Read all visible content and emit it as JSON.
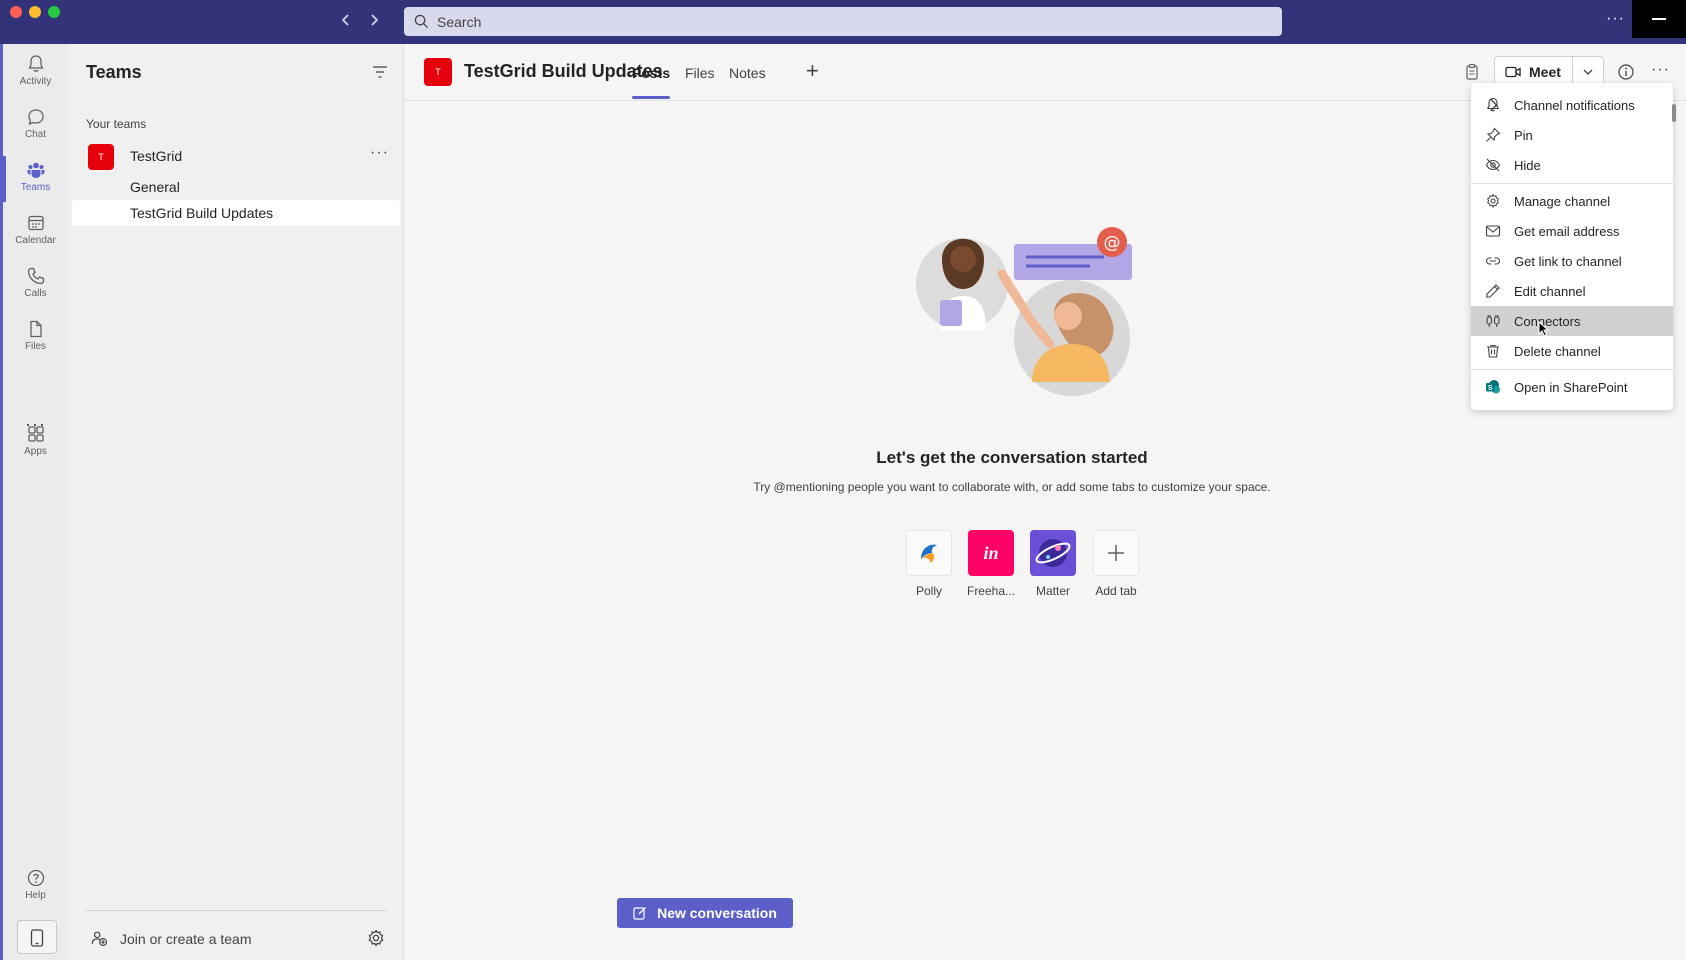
{
  "titlebar": {
    "search_placeholder": "Search",
    "back_icon": "chevron-left-icon",
    "forward_icon": "chevron-right-icon",
    "more_label": "···"
  },
  "rail": {
    "items": [
      {
        "label": "Activity",
        "icon": "bell-icon"
      },
      {
        "label": "Chat",
        "icon": "chat-icon"
      },
      {
        "label": "Teams",
        "icon": "teams-icon",
        "active": true
      },
      {
        "label": "Calendar",
        "icon": "calendar-icon"
      },
      {
        "label": "Calls",
        "icon": "phone-icon"
      },
      {
        "label": "Files",
        "icon": "file-icon"
      },
      {
        "label": "Apps",
        "icon": "apps-icon"
      },
      {
        "label": "Help",
        "icon": "help-icon"
      }
    ],
    "more_label": "···"
  },
  "team_panel": {
    "title": "Teams",
    "section_label": "Your teams",
    "team": {
      "avatar": "T",
      "name": "TestGrid",
      "more_label": "···"
    },
    "channels": [
      "General",
      "TestGrid Build Updates"
    ],
    "join_label": "Join or create a team"
  },
  "header": {
    "avatar": "T",
    "title": "TestGrid Build Updates",
    "tabs": [
      "Posts",
      "Files",
      "Notes"
    ],
    "add_tab_label": "+",
    "meet_label": "Meet",
    "more_label": "···"
  },
  "empty_state": {
    "title": "Let's get the conversation started",
    "subtitle": "Try @mentioning people you want to collaborate with, or add some tabs to customize your space.",
    "apps": [
      {
        "name": "Polly",
        "color": "#1f6fd1"
      },
      {
        "name": "Freeha...",
        "color": "#ff0066"
      },
      {
        "name": "Matter",
        "color": "#6b4fd6"
      },
      {
        "name": "Add tab",
        "color": "#616161"
      }
    ],
    "new_conversation_label": "New conversation"
  },
  "menu": {
    "items": [
      {
        "label": "Channel notifications",
        "icon": "bell-icon",
        "has_submenu": true
      },
      {
        "label": "Pin",
        "icon": "pin-icon"
      },
      {
        "label": "Hide",
        "icon": "eye-off-icon"
      },
      {
        "label": "Manage channel",
        "icon": "gear-icon"
      },
      {
        "label": "Get email address",
        "icon": "mail-icon"
      },
      {
        "label": "Get link to channel",
        "icon": "link-icon"
      },
      {
        "label": "Edit channel",
        "icon": "pencil-icon"
      },
      {
        "label": "Connectors",
        "icon": "connector-icon",
        "hovered": true
      },
      {
        "label": "Delete channel",
        "icon": "trash-icon"
      },
      {
        "label": "Open in SharePoint",
        "icon": "sharepoint-icon"
      }
    ]
  },
  "colors": {
    "brand": "#5b5fc7",
    "titlebar": "#33337a",
    "team_avatar": "#e5000b"
  }
}
